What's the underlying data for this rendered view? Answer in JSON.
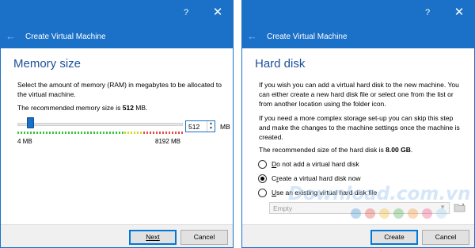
{
  "left_dialog": {
    "title_help": "?",
    "title_close": "✕",
    "header_title": "Create Virtual Machine",
    "heading": "Memory size",
    "description_line1": "Select the amount of memory (RAM) in megabytes to be allocated to",
    "description_line2": "the virtual machine.",
    "recommended_prefix": "The recommended memory size is ",
    "recommended_value": "512",
    "recommended_suffix": " MB.",
    "memory_value": "512",
    "unit": "MB",
    "min_label": "4 MB",
    "max_label": "8192 MB",
    "slider_fraction": 0.0621,
    "next_label": "Next",
    "cancel_label": "Cancel"
  },
  "right_dialog": {
    "title_help": "?",
    "title_close": "✕",
    "header_title": "Create Virtual Machine",
    "heading": "Hard disk",
    "para1_line1": "If you wish you can add a virtual hard disk to the new machine. You",
    "para1_line2": "can either create a new hard disk file or select one from the list or",
    "para1_line3": "from another location using the folder icon.",
    "para2_line1": "If you need a more complex storage set-up you can skip this step",
    "para2_line2": "and make the changes to the machine settings once the machine is",
    "para2_line3": "created.",
    "recommended_prefix": "The recommended size of the hard disk is ",
    "recommended_value": "8.00 GB",
    "recommended_suffix": ".",
    "option1_u": "D",
    "option1_rest": "o not add a virtual hard disk",
    "option2_pre": "C",
    "option2_u": "r",
    "option2_rest": "eate a virtual hard disk now",
    "option3_u": "U",
    "option3_rest": "se an existing virtual hard disk file",
    "selected_option": 2,
    "disk_select_value": "Empty",
    "create_label": "Create",
    "cancel_label": "Cancel"
  },
  "watermark": {
    "text": "Download.com.vn",
    "dot_colors": [
      "#3f8fd6",
      "#e9473f",
      "#f3b82a",
      "#4cae4f",
      "#f59331",
      "#ef4c7d",
      "#9bd1f0"
    ]
  }
}
